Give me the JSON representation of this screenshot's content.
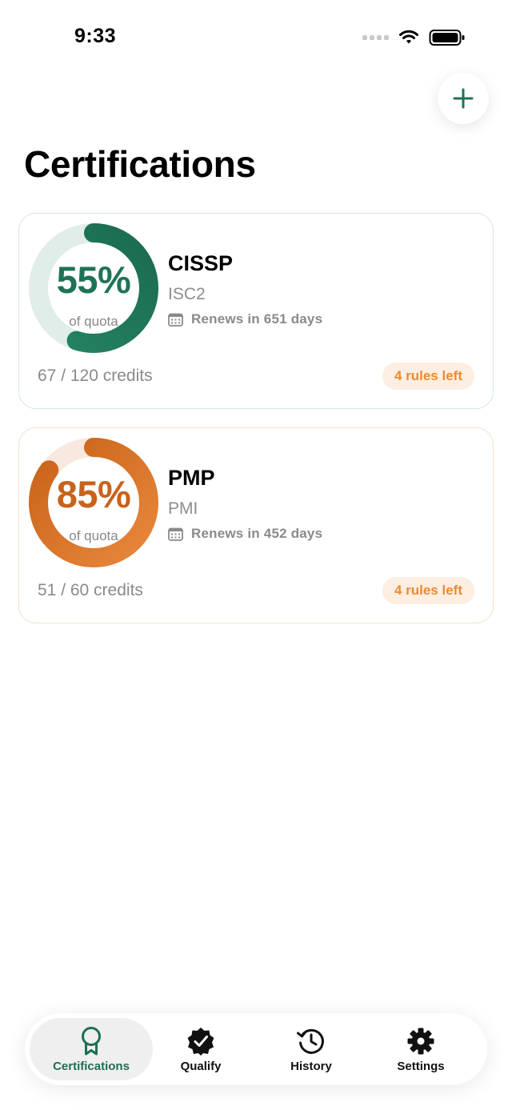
{
  "status_bar": {
    "time": "9:33"
  },
  "header": {
    "title": "Certifications",
    "add_icon": "plus-icon"
  },
  "colors": {
    "green_accent": "#1e7356",
    "orange_accent": "#d96a1e",
    "badge_text": "#ef8a2d",
    "badge_bg": "#fdeee2"
  },
  "certifications": [
    {
      "name": "CISSP",
      "org": "ISC2",
      "progress_pct": "55%",
      "progress_fraction": 0.55,
      "quota_label": "of quota",
      "renews": "Renews in 651 days",
      "credits": "67 / 120 credits",
      "rules_left": "4 rules left"
    },
    {
      "name": "PMP",
      "org": "PMI",
      "progress_pct": "85%",
      "progress_fraction": 0.85,
      "quota_label": "of quota",
      "renews": "Renews in 452 days",
      "credits": "51 / 60 credits",
      "rules_left": "4 rules left"
    }
  ],
  "tabs": [
    {
      "label": "Certifications",
      "icon": "ribbon-icon",
      "active": true
    },
    {
      "label": "Qualify",
      "icon": "check-badge-icon",
      "active": false
    },
    {
      "label": "History",
      "icon": "history-icon",
      "active": false
    },
    {
      "label": "Settings",
      "icon": "gear-icon",
      "active": false
    }
  ]
}
